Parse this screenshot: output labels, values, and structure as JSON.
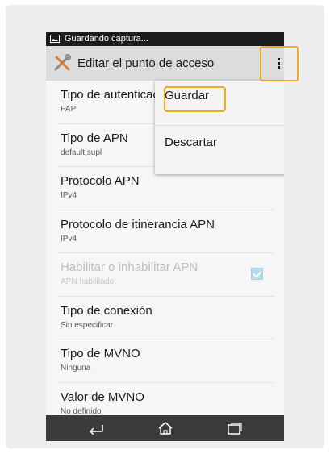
{
  "status_bar": {
    "icon": "screenshot-icon",
    "text": "Guardando captura..."
  },
  "action_bar": {
    "icon": "tools-icon",
    "title": "Editar el punto de acceso",
    "overflow_icon": "overflow-menu-icon"
  },
  "overflow_menu": {
    "items": [
      "Guardar",
      "Descartar"
    ]
  },
  "settings": [
    {
      "title": "Tipo de autenticación",
      "value": "PAP"
    },
    {
      "title": "Tipo de APN",
      "value": "default,supl"
    },
    {
      "title": "Protocolo APN",
      "value": "IPv4"
    },
    {
      "title": "Protocolo de itinerancia APN",
      "value": "IPv4"
    },
    {
      "title": "Habilitar o inhabilitar APN",
      "value": "APN habilitado",
      "enabled": false,
      "checked": true
    },
    {
      "title": "Tipo de conexión",
      "value": "Sin especificar"
    },
    {
      "title": "Tipo de MVNO",
      "value": "Ninguna"
    },
    {
      "title": "Valor de MVNO",
      "value": "No definido"
    }
  ],
  "nav_bar": {
    "icons": [
      "back-icon",
      "home-icon",
      "recents-icon"
    ]
  },
  "colors": {
    "highlight": "#f5a623",
    "action_bar": "#dcdcdc",
    "nav_bar": "#3b3b3b",
    "status_bar": "#1d1d1d"
  }
}
